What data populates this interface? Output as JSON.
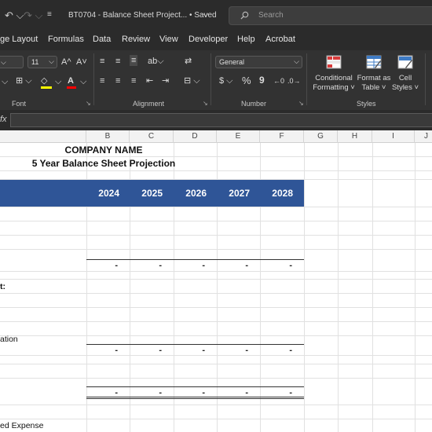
{
  "titlebar": {
    "undo_icon": "undo-icon",
    "redo_icon": "redo-icon",
    "more_icon": "customize-qat-icon",
    "document_title": "BT0704 - Balance Sheet Project... • Saved",
    "title_caret": "⌵",
    "search_placeholder": "Search"
  },
  "menu": {
    "tabs": [
      "ge Layout",
      "Formulas",
      "Data",
      "Review",
      "View",
      "Developer",
      "Help",
      "Acrobat"
    ]
  },
  "ribbon": {
    "font": {
      "size_value": "11",
      "grow_label": "A^",
      "shrink_label": "A˅",
      "group_label": "Font"
    },
    "alignment": {
      "group_label": "Alignment"
    },
    "number": {
      "format_value": "General",
      "currency_label": "$",
      "percent_label": "%",
      "comma_label": "9",
      "group_label": "Number"
    },
    "styles": {
      "conditional_formatting": [
        "Conditional",
        "Formatting ˅"
      ],
      "format_as_table": [
        "Format as",
        "Table ˅"
      ],
      "cell_styles": [
        "Cell",
        "Styles ˅"
      ],
      "group_label": "Styles"
    },
    "accent_colors": {
      "highlight": "#ffff00",
      "font_color": "#ff0000"
    }
  },
  "formula_bar": {
    "fx_label": "fx",
    "value": ""
  },
  "columns": [
    "B",
    "C",
    "D",
    "E",
    "F",
    "G",
    "H",
    "I",
    "J"
  ],
  "sheet": {
    "company_name": "COMPANY NAME",
    "subtitle": "5 Year Balance Sheet Projection",
    "header_color": "#2f5597",
    "years": [
      "2024",
      "2025",
      "2026",
      "2027",
      "2028"
    ],
    "dash": "-",
    "row_labels": {
      "row1": "t:",
      "row2": "ation",
      "row3": "ed Expense"
    }
  }
}
